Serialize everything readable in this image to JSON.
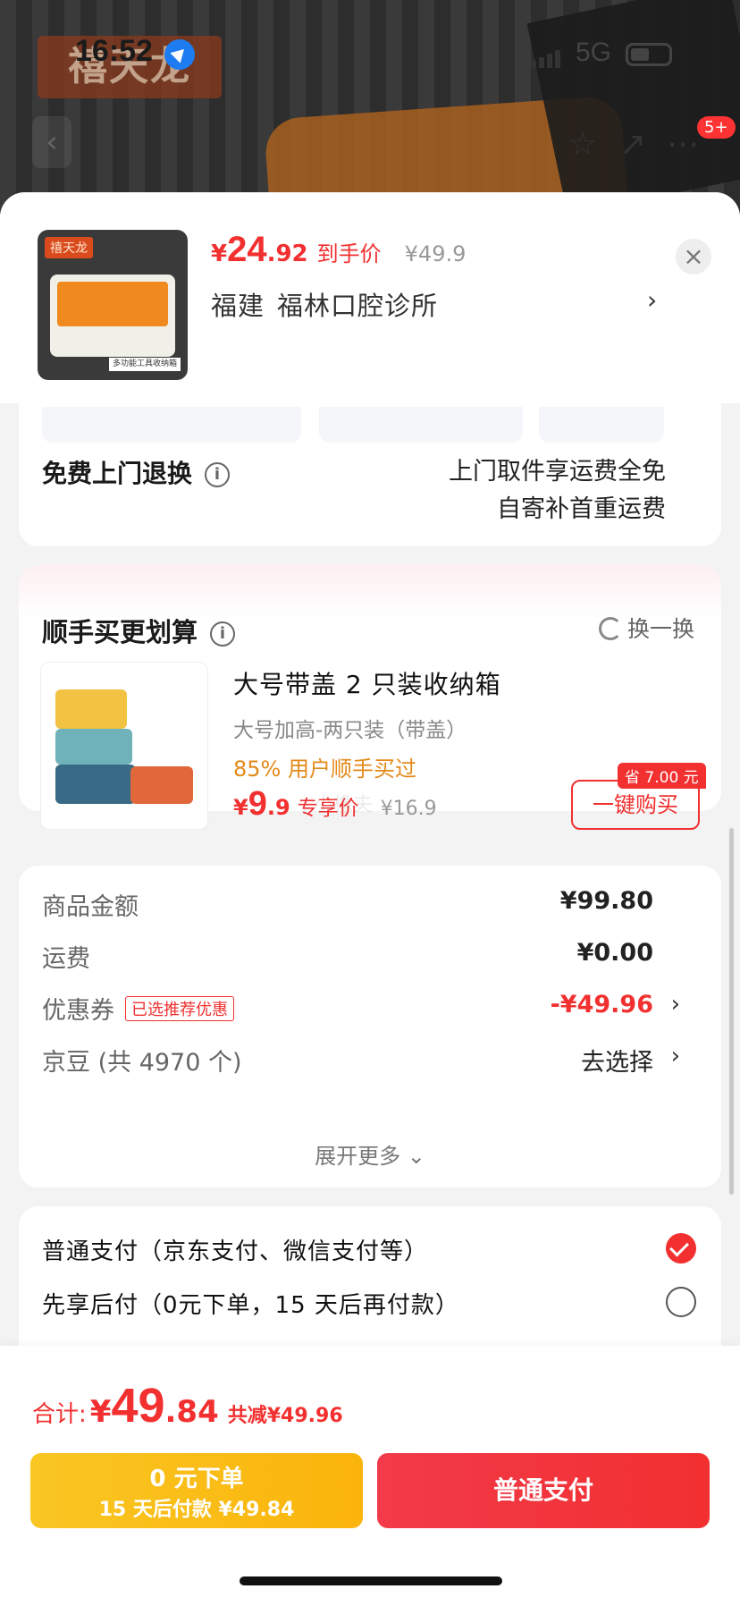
{
  "status_bar": {
    "time": "16:52",
    "network": "5G"
  },
  "hero": {
    "brand": "禧天龙"
  },
  "top_nav": {
    "cart_badge": "5+"
  },
  "product": {
    "thumb_logo": "禧天龙",
    "thumb_tag": "多功能工具收纳箱",
    "price_currency": "¥",
    "price_int": "24",
    "price_dec": ".92",
    "price_label": "到手价",
    "original_price": "¥49.9",
    "province": "福建",
    "address": "福林口腔诊所"
  },
  "service": {
    "title": "免费上门退换",
    "line1": "上门取件享运费全免",
    "line2": "自寄补首重运费"
  },
  "addon": {
    "title": "顺手买更划算",
    "swap": "换一换",
    "name": "大号带盖 2 只装收纳箱",
    "spec": "大号加高-两只装（带盖）",
    "popularity": "85% 用户顺手买过",
    "price_currency": "¥",
    "price_int": "9",
    "price_dec": ".9",
    "price_label": "专享价",
    "original_price": "¥16.9",
    "save_tag": "省 7.00 元",
    "buy_button": "一键购买",
    "watermark": "小橡夫"
  },
  "summary": {
    "goods_label": "商品金额",
    "goods_value": "¥99.80",
    "shipping_label": "运费",
    "shipping_value": "¥0.00",
    "coupon_label": "优惠券",
    "coupon_tag": "已选推荐优惠",
    "coupon_value": "-¥49.96",
    "beans_label": "京豆 (共 4970 个)",
    "beans_value": "去选择",
    "expand": "展开更多"
  },
  "payment": {
    "option1": "普通支付（京东支付、微信支付等）",
    "option2": "先享后付（0元下单，15 天后再付款）"
  },
  "footer": {
    "total_label": "合计:",
    "total_currency": "¥",
    "total_int": "49",
    "total_dec": ".84",
    "total_reduction": "共减¥49.96",
    "later_line1": "0 元下单",
    "later_line2": "15 天后付款 ¥49.84",
    "pay_button": "普通支付"
  },
  "colors": {
    "accent_red": "#f23030",
    "accent_yellow": "#f9c623",
    "accent_orange": "#e38a1a"
  }
}
